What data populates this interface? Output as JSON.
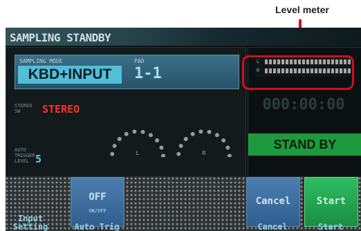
{
  "annotation": {
    "label": "Level meter"
  },
  "screen": {
    "title": "SAMPLING STANDBY",
    "mode": {
      "label": "SAMPLING MODE",
      "value": "KBD+INPUT"
    },
    "pad": {
      "label": "PAD",
      "value": "1-1"
    },
    "stereo_sw": {
      "label": "STEREO SW",
      "value": "STEREO"
    },
    "auto_trigger": {
      "label": "AUTO TRIGGER LEVEL",
      "value": "5"
    },
    "knobs": {
      "left": "L",
      "right": "R"
    },
    "meter": {
      "left": "L",
      "right": "R"
    },
    "time": "000:00:00",
    "status": "STAND BY"
  },
  "buttons": {
    "auto_trig": {
      "main": "OFF",
      "sub": "ON/OFF"
    },
    "cancel": "Cancel",
    "start": "Start"
  },
  "footer": {
    "input_setting": "Input Setting",
    "auto_trig": "Auto Trig",
    "cancel": "Cancel",
    "start": "Start"
  },
  "colors": {
    "accent_cyan": "#52bfd6",
    "stereo_red": "#ff2e2e",
    "status_green": "#1e9a3e",
    "callout_red": "#d0101b"
  }
}
